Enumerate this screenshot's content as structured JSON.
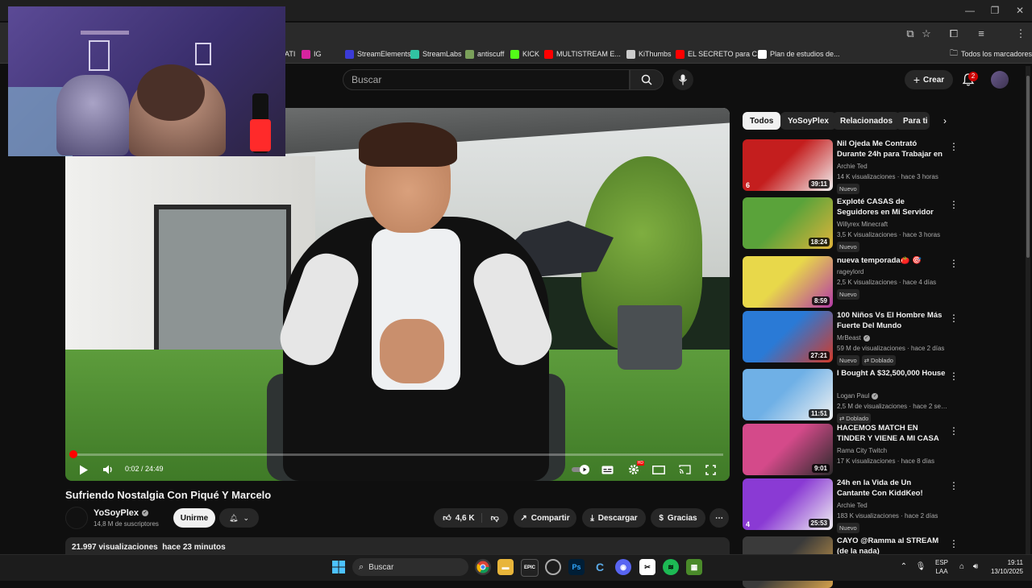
{
  "browser": {
    "bookmarks": [
      {
        "label": "ATI",
        "icon": "bookmark-icon",
        "color": "#888888"
      },
      {
        "label": "IG",
        "icon": "instagram-icon",
        "color": "#d6249f"
      },
      {
        "label": "StreamElements",
        "icon": "streamelements-icon",
        "color": "#3b3bd6"
      },
      {
        "label": "StreamLabs",
        "icon": "streamlabs-icon",
        "color": "#31c3a2"
      },
      {
        "label": "antiscuff",
        "icon": "antiscuff-icon",
        "color": "#7aa05a"
      },
      {
        "label": "KICK",
        "icon": "kick-icon",
        "color": "#53fc18"
      },
      {
        "label": "MULTISTREAM E...",
        "icon": "youtube-icon",
        "color": "#ff0000"
      },
      {
        "label": "KiThumbs",
        "icon": "kithumbs-icon",
        "color": "#cccccc"
      },
      {
        "label": "EL SECRETO para C...",
        "icon": "youtube-icon",
        "color": "#ff0000"
      },
      {
        "label": "Plan de estudios de...",
        "icon": "up-icon",
        "color": "#ffffff"
      }
    ],
    "all_bookmarks": "Todos los marcadores"
  },
  "header": {
    "search_placeholder": "Buscar",
    "create_label": "Crear",
    "notifications_count": "2"
  },
  "player": {
    "time": "0:02 / 24:49",
    "progress": 0.0013
  },
  "video": {
    "title": "Sufriendo Nostalgia Con Piqué Y Marcelo",
    "channel": "YoSoyPlex",
    "subscribers": "14,8 M de suscriptores",
    "join_label": "Unirme",
    "likes": "4,6 K",
    "share_label": "Compartir",
    "download_label": "Descargar",
    "thanks_label": "Gracias",
    "views": "21.997 visualizaciones",
    "published": "hace 23 minutos"
  },
  "chips": [
    "Todos",
    "YoSoyPlex",
    "Relacionados",
    "Para ti"
  ],
  "recommendations": [
    {
      "title": "Nil Ojeda Me Contrató Durante 24h para Trabajar en ...",
      "channel": "Archie Ted",
      "verified": false,
      "meta": "14 K visualizaciones · hace 3 horas",
      "duration": "39:11",
      "num": "6",
      "badges": [
        "Nuevo"
      ],
      "colors": [
        "#c41e1e",
        "#f2f2f2"
      ]
    },
    {
      "title": "Exploté CASAS de Seguidores en Mi Servidor",
      "channel": "Willyrex Minecraft",
      "verified": false,
      "meta": "3,5 K visualizaciones · hace 3 horas",
      "duration": "18:24",
      "num": "",
      "badges": [
        "Nuevo"
      ],
      "colors": [
        "#5aa33a",
        "#e0b43a"
      ]
    },
    {
      "title": "nueva temporada🍅 🎯",
      "channel": "rageylord",
      "verified": false,
      "meta": "2,5 K visualizaciones · hace 4 días",
      "duration": "8:59",
      "num": "",
      "badges": [
        "Nuevo"
      ],
      "colors": [
        "#e8d84a",
        "#b43aa6"
      ]
    },
    {
      "title": "100 Niños Vs El Hombre Más Fuerte Del Mundo",
      "channel": "MrBeast",
      "verified": true,
      "meta": "59 M de visualizaciones · hace 2 días",
      "duration": "27:21",
      "num": "",
      "badges": [
        "Nuevo",
        "Doblado"
      ],
      "colors": [
        "#2a7ad6",
        "#d23a2a"
      ]
    },
    {
      "title": "I Bought A $32,500,000 House",
      "channel": "Logan Paul",
      "verified": true,
      "meta": "2,5 M de visualizaciones · hace 2 semanas",
      "duration": "11:51",
      "num": "",
      "badges": [
        "Doblado"
      ],
      "colors": [
        "#6fb0e6",
        "#f2f2f2"
      ]
    },
    {
      "title": "HACEMOS MATCH EN TINDER Y VIENE A MI CASA",
      "channel": "Rama City Twitch",
      "verified": false,
      "meta": "17 K visualizaciones · hace 8 días",
      "duration": "9:01",
      "num": "",
      "badges": [],
      "colors": [
        "#d44a8a",
        "#2a2a2a"
      ]
    },
    {
      "title": "24h en la Vida de Un Cantante Con KiddKeo!",
      "channel": "Archie Ted",
      "verified": false,
      "meta": "183 K visualizaciones · hace 2 días",
      "duration": "25:53",
      "num": "4",
      "badges": [
        "Nuevo"
      ],
      "colors": [
        "#8a3ad4",
        "#f2f2f2"
      ]
    },
    {
      "title": "CAYO @Ramma al STREAM (de la nada)",
      "channel": "",
      "verified": false,
      "meta": "",
      "duration": "",
      "num": "",
      "badges": [],
      "colors": [
        "#3a3a3a",
        "#d4a04a"
      ]
    }
  ],
  "taskbar": {
    "search": "Buscar",
    "lang": "ESP",
    "layout": "LAA",
    "time": "19:11",
    "date": "13/10/2025"
  }
}
